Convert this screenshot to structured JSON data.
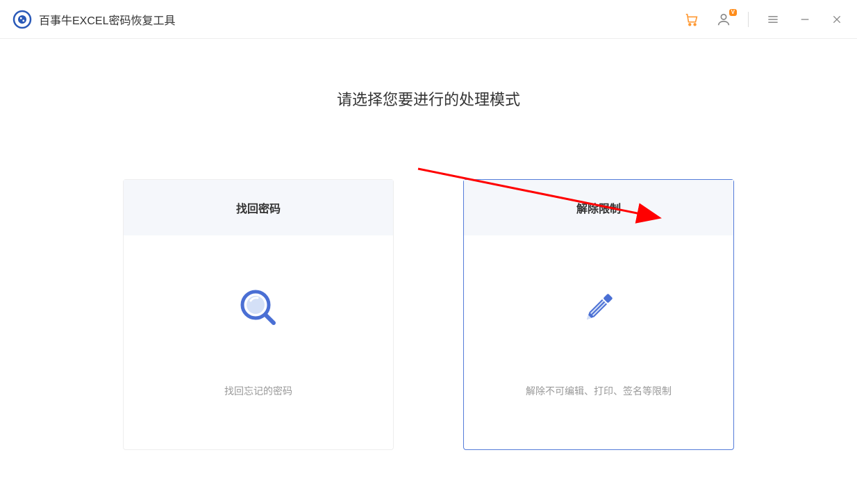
{
  "header": {
    "app_title": "百事牛EXCEL密码恢复工具",
    "vip_badge": "V"
  },
  "main": {
    "page_title": "请选择您要进行的处理模式",
    "cards": [
      {
        "title": "找回密码",
        "desc": "找回忘记的密码"
      },
      {
        "title": "解除限制",
        "desc": "解除不可编辑、打印、签名等限制"
      }
    ]
  }
}
